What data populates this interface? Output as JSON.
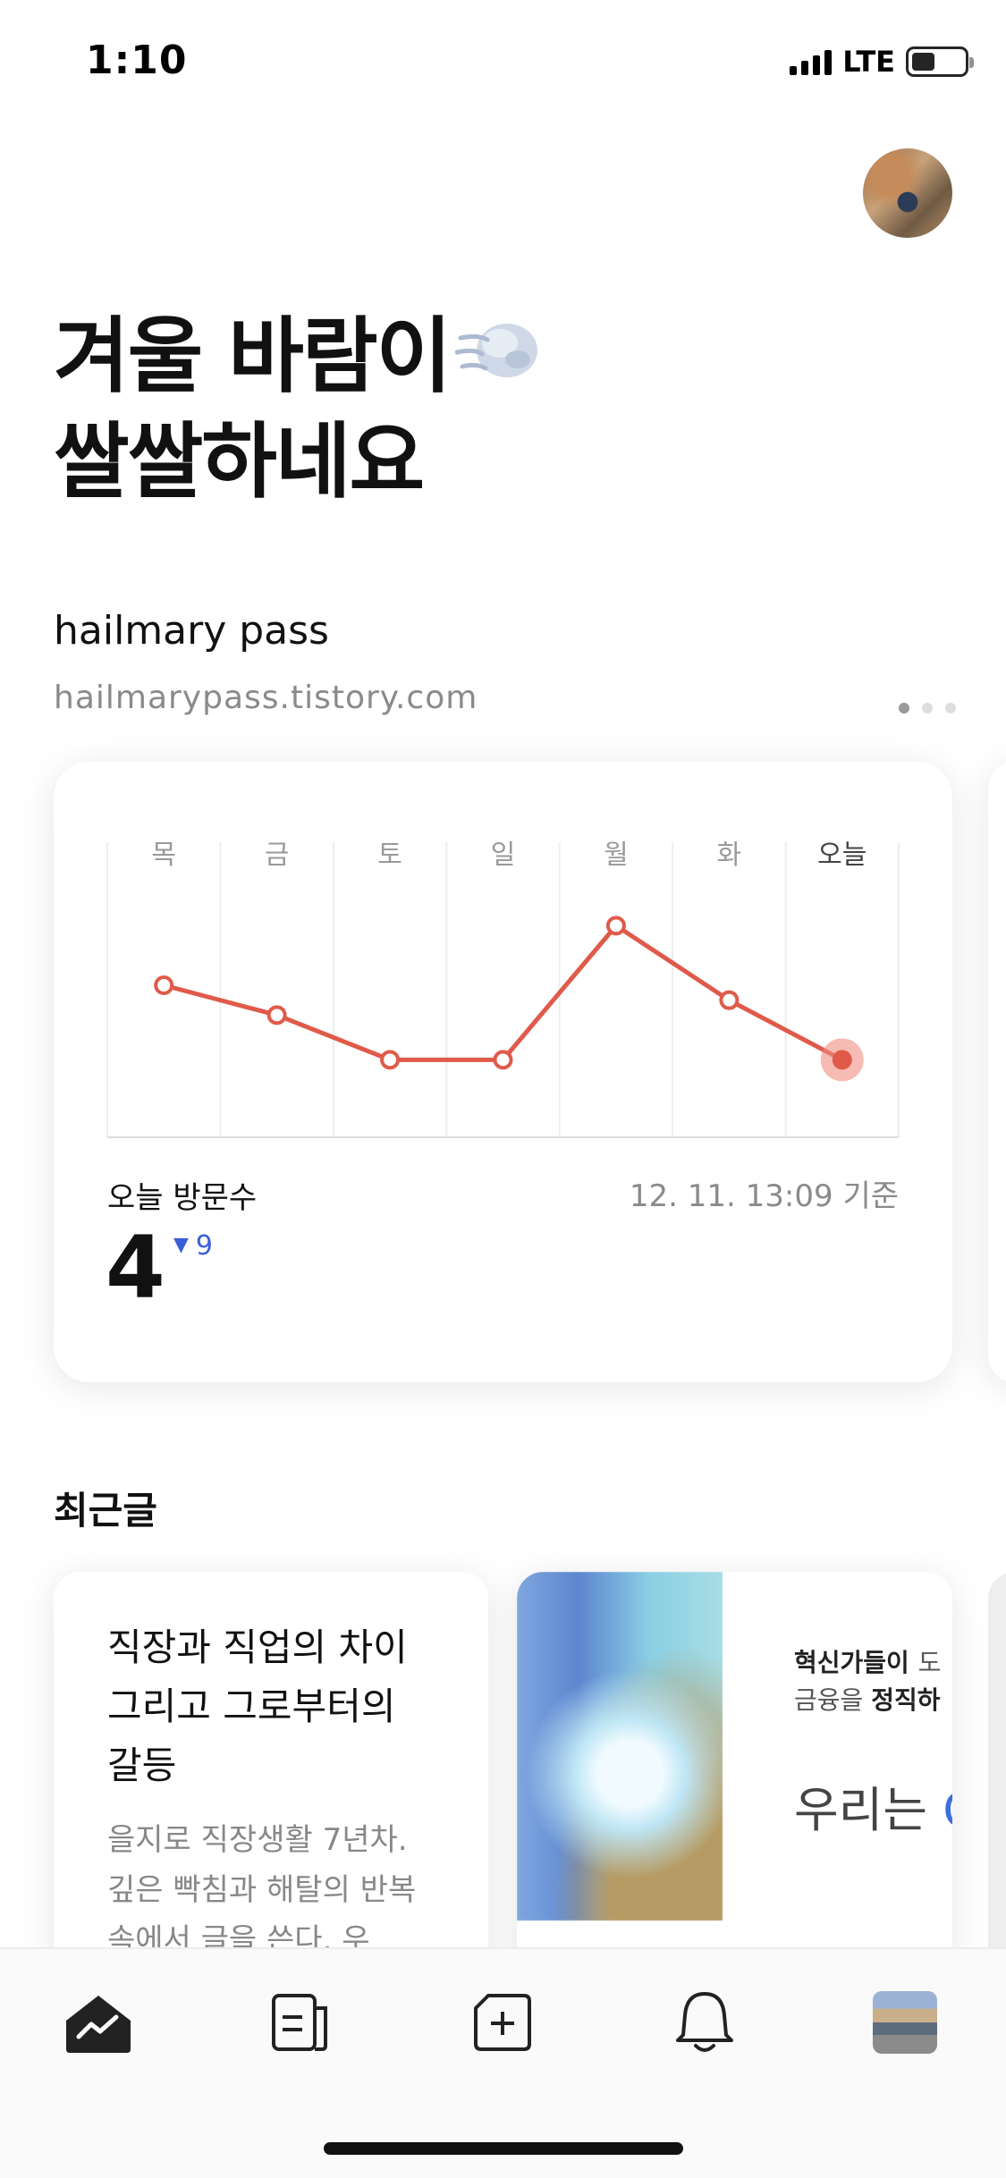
{
  "status_bar": {
    "time": "1:10",
    "network": "LTE"
  },
  "headline": {
    "line1": "겨울 바람이",
    "line2": "쌀쌀하네요",
    "emoji_icon": "wind-blowing-face-icon"
  },
  "blog": {
    "name": "hailmary pass",
    "url": "hailmarypass.tistory.com"
  },
  "pager": {
    "count": 3,
    "active": 0
  },
  "stats": {
    "visitors_label": "오늘 방문수",
    "updated": "12. 11. 13:09 기준",
    "today_count": "4",
    "delta_value": "9",
    "delta_direction": "down"
  },
  "chart_data": {
    "type": "line",
    "categories": [
      "목",
      "금",
      "토",
      "일",
      "월",
      "화",
      "오늘"
    ],
    "series": [
      {
        "values": [
          9,
          7,
          4,
          4,
          13,
          8,
          4
        ]
      }
    ],
    "ylim": [
      0,
      15
    ],
    "grid": "vertical",
    "colors": {
      "line": "#e05a4a",
      "highlight": "#f08d80"
    }
  },
  "recent": {
    "title": "최근글",
    "posts": [
      {
        "title": "직장과 직업의 차이 그리고 그로부터의 갈등",
        "excerpt": "을지로 직장생활 7년차. 깊은 빡침과 해탈의 반복 속에서 글을 쓴다. 우"
      },
      {
        "line1_prefix": "혁신가들이 ",
        "line1_suffix": "도",
        "line2_prefix": "금융을 ",
        "line2_bold": "정직하",
        "big_prefix": "우리는 ",
        "big_accent": "C"
      }
    ]
  },
  "tabs": [
    "stats-icon",
    "posts-icon",
    "new-post-icon",
    "notification-bell-icon",
    "profile-thumbnail"
  ]
}
